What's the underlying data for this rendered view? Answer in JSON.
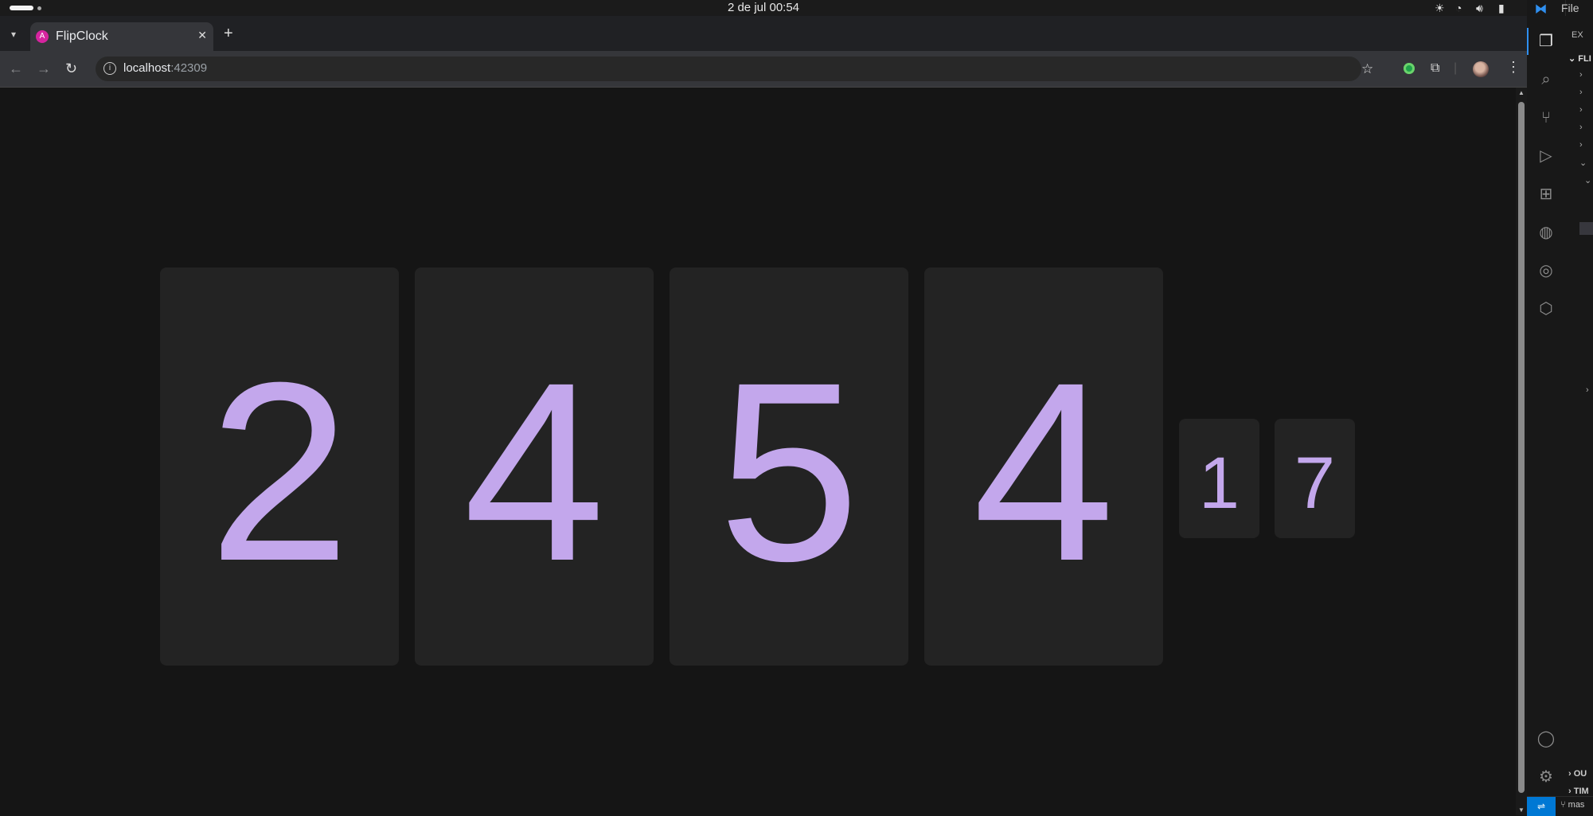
{
  "os_bar": {
    "clock": "2 de jul  00:54"
  },
  "browser": {
    "tab": {
      "title": "FlipClock",
      "favicon_icon": "angular-icon"
    },
    "url": {
      "host": "localhost",
      "port": ":42309"
    }
  },
  "clock": {
    "big_digits": [
      "2",
      "4",
      "5",
      "4"
    ],
    "small_digits": [
      "1",
      "7"
    ],
    "digit_color": "#c3a7ec"
  },
  "vscode": {
    "menu_file": "File",
    "explorer_title": "EX",
    "explorer_root": "FLI",
    "outline": "OU",
    "timeline": "TIM",
    "branch": "mas",
    "accent_color": "#0078d4"
  }
}
